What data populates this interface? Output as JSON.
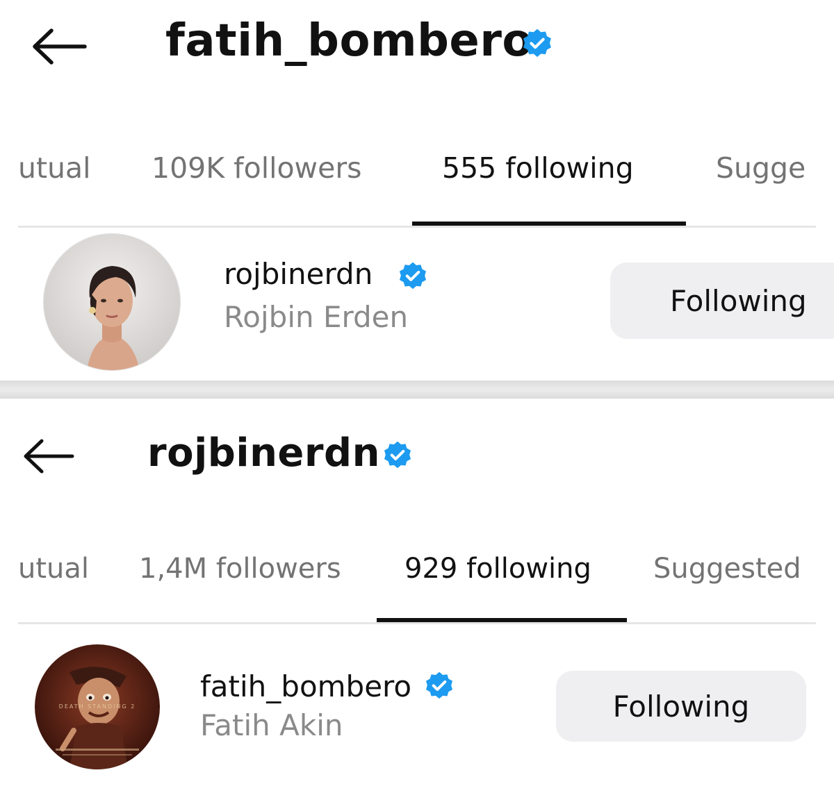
{
  "screenshots": [
    {
      "header": {
        "back_icon": "arrow-left-icon",
        "title": "fatih_bombero",
        "verified": true
      },
      "tabs": [
        {
          "label": "utual",
          "active": false
        },
        {
          "label": "109K followers",
          "active": false
        },
        {
          "label": "555 following",
          "active": true
        },
        {
          "label": "Sugge",
          "active": false
        }
      ],
      "row": {
        "username": "rojbinerdn",
        "full_name": "Rojbin Erden",
        "verified": true,
        "button": "Following",
        "avatar": "profile-photo-woman"
      }
    },
    {
      "header": {
        "back_icon": "arrow-left-icon",
        "title": "rojbinerdn",
        "verified": true
      },
      "tabs": [
        {
          "label": "utual",
          "active": false
        },
        {
          "label": "1,4M followers",
          "active": false
        },
        {
          "label": "929 following",
          "active": true
        },
        {
          "label": "Suggested",
          "active": false
        }
      ],
      "row": {
        "username": "fatih_bombero",
        "full_name": "Fatih Akin",
        "verified": true,
        "button": "Following",
        "avatar": "movie-poster-puppet",
        "avatar_text": "DEATH STANDING 2"
      }
    }
  ],
  "colors": {
    "verified_blue": "#1d9bf0",
    "muted_text": "#737373",
    "button_bg": "#efeff1"
  }
}
